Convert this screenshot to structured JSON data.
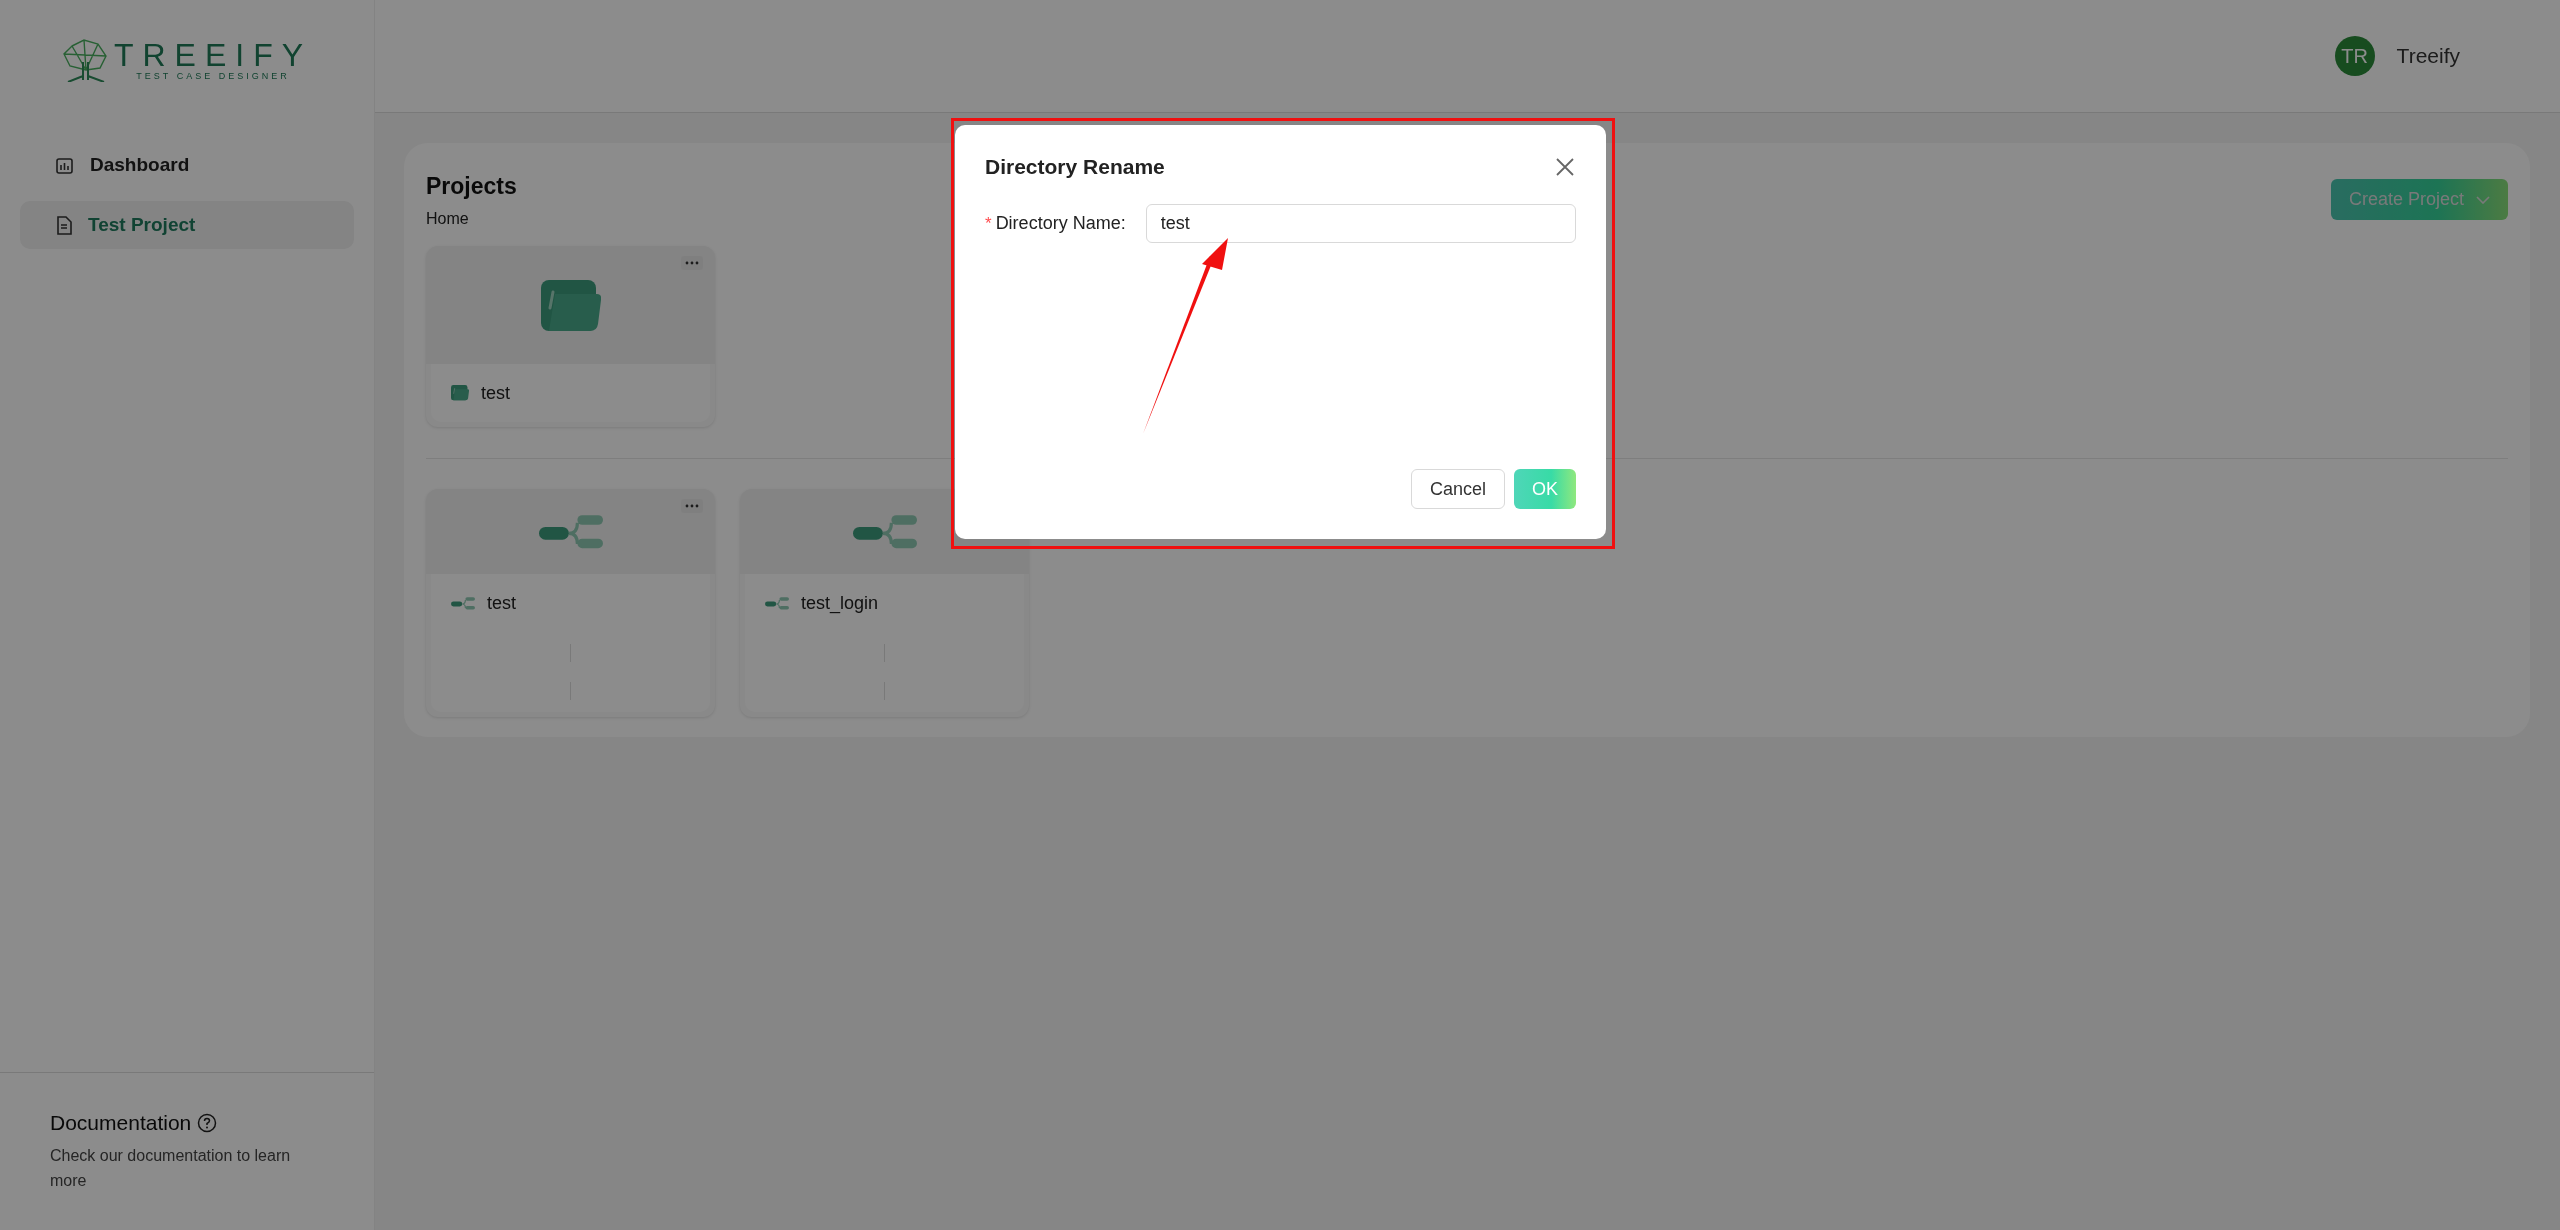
{
  "brand": {
    "name": "TREEIFY",
    "tagline": "TEST CASE DESIGNER"
  },
  "sidebar": {
    "items": [
      {
        "label": "Dashboard",
        "kind": "dashboard",
        "selected": false
      },
      {
        "label": "Test Project",
        "kind": "document",
        "selected": true
      }
    ],
    "documentation": {
      "title": "Documentation",
      "text": "Check our documentation to learn more"
    }
  },
  "user": {
    "initials": "TR",
    "name": "Treeify"
  },
  "projects": {
    "title": "Projects",
    "breadcrumb": "Home",
    "create_button": "Create Project",
    "folders": [
      {
        "name": "test",
        "has_menu": true
      }
    ],
    "mindmaps": [
      {
        "name": "test",
        "has_menu": true
      },
      {
        "name": "test_login"
      }
    ]
  },
  "dialog": {
    "title": "Directory Rename",
    "field": {
      "required_mark": "*",
      "label": "Directory Name:",
      "value": "test"
    },
    "buttons": [
      {
        "label": "Cancel",
        "kind": "default"
      },
      {
        "label": "OK",
        "kind": "primary"
      }
    ]
  }
}
